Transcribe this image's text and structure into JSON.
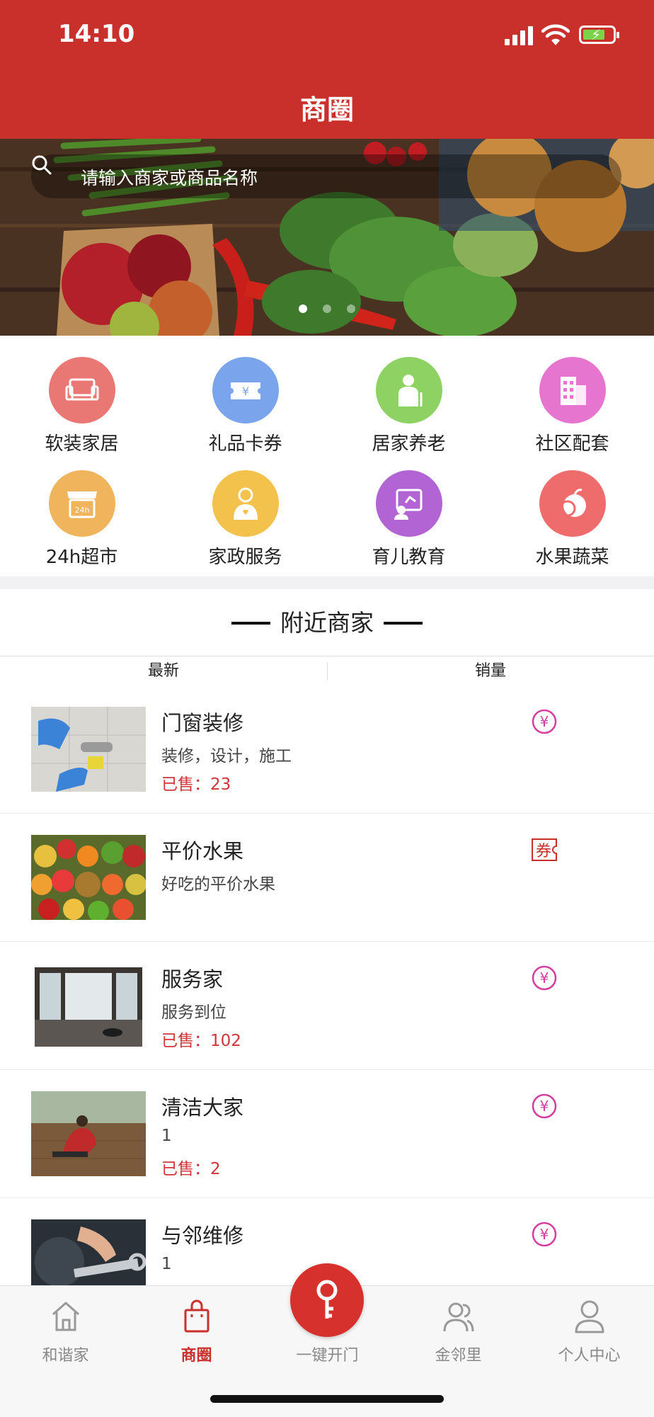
{
  "status_bar": {
    "time": "14:10"
  },
  "header": {
    "title": "商圈"
  },
  "banner": {
    "search_placeholder": "请输入商家或商品名称",
    "slides": 3,
    "active_slide": 1
  },
  "categories": [
    {
      "label": "软装家居",
      "icon": "sofa-icon",
      "color": "#e97774"
    },
    {
      "label": "礼品卡券",
      "icon": "ticket-icon",
      "color": "#7aa5ec"
    },
    {
      "label": "居家养老",
      "icon": "elder-care-icon",
      "color": "#8dd262"
    },
    {
      "label": "社区配套",
      "icon": "building-icon",
      "color": "#e675d0"
    },
    {
      "label": "24h超市",
      "icon": "store-24h-icon",
      "color": "#f0b55c"
    },
    {
      "label": "家政服务",
      "icon": "housekeeper-icon",
      "color": "#f2c24d"
    },
    {
      "label": "育儿教育",
      "icon": "education-icon",
      "color": "#b264d4"
    },
    {
      "label": "水果蔬菜",
      "icon": "fruit-icon",
      "color": "#ef6c6c"
    }
  ],
  "nearby": {
    "title": "附近商家",
    "sort_tabs": [
      "最新",
      "销量"
    ]
  },
  "merchants": [
    {
      "name": "门窗装修",
      "desc": "装修，设计，施工",
      "sold": "已售：23",
      "badge": "yen-badge-icon"
    },
    {
      "name": "平价水果",
      "desc": "好吃的平价水果",
      "sold": "",
      "badge": "coupon-badge-icon"
    },
    {
      "name": "服务家",
      "desc": "服务到位",
      "sold": "已售：102",
      "badge": "yen-badge-icon"
    },
    {
      "name": "清洁大家",
      "desc": "1",
      "sold": "已售：2",
      "badge": "yen-badge-icon"
    },
    {
      "name": "与邻维修",
      "desc": "1",
      "sold": "",
      "badge": "yen-badge-icon"
    }
  ],
  "coupon_badge_text": "券",
  "yen_badge_text": "¥",
  "tabbar": {
    "items": [
      {
        "label": "和谐家",
        "icon": "house-icon"
      },
      {
        "label": "商圈",
        "icon": "shopping-bag-icon",
        "active": true
      },
      {
        "label": "一键开门",
        "icon": "key-icon"
      },
      {
        "label": "金邻里",
        "icon": "neighbors-icon"
      },
      {
        "label": "个人中心",
        "icon": "person-icon"
      }
    ]
  },
  "colors": {
    "brand": "#c9302c",
    "sold": "#d0353a",
    "badge": "#d63d9e"
  }
}
